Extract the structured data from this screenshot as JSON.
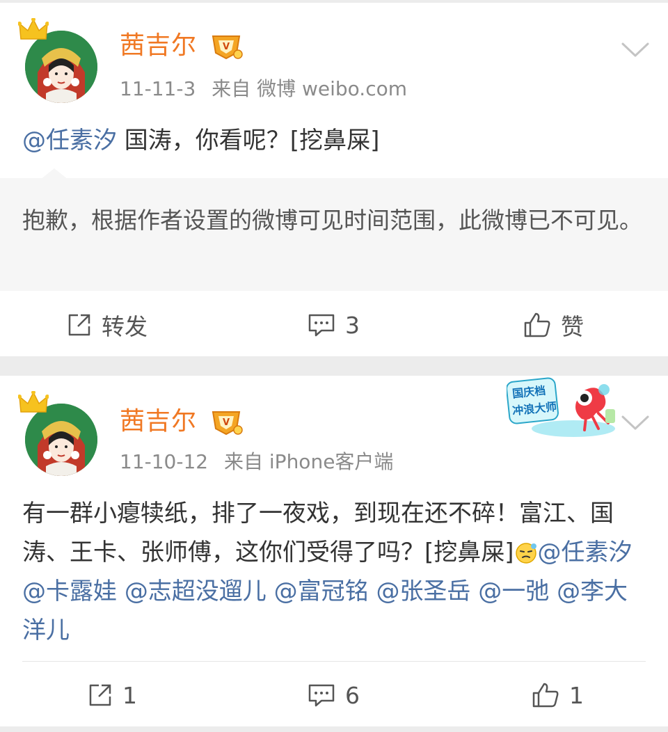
{
  "posts": [
    {
      "author": "茜吉尔",
      "date": "11-11-3",
      "source": "来自 微博 weibo.com",
      "content": {
        "mention": "@任素汐",
        "text": " 国涛，你看呢？[挖鼻屎]"
      },
      "quoted_notice": "抱歉，根据作者设置的微博可见时间范围，此微博已不可见。",
      "actions": {
        "repost": "转发",
        "comment": "3",
        "like": "赞"
      }
    },
    {
      "author": "茜吉尔",
      "date": "11-10-12",
      "source": "来自 iPhone客户端",
      "badge_sticker": [
        "国庆档",
        "冲浪大师"
      ],
      "content": {
        "text": "有一群小瘪犊纸，排了一夜戏，到现在还不碎！富江、国涛、王卡、张师傅，这你们受得了吗？[挖鼻屎]",
        "mentions": [
          "@任素汐",
          "@卡露娃",
          "@志超没遛儿",
          "@富冠铭",
          "@张圣岳",
          "@一弛",
          "@李大洋儿"
        ]
      },
      "actions": {
        "repost": "1",
        "comment": "6",
        "like": "1"
      }
    }
  ],
  "colors": {
    "author_name": "#f07823",
    "mention": "#4a6fa3",
    "meta": "#8a8a8a",
    "background": "#ececec"
  },
  "icons": [
    "crown-icon",
    "vip-badge-icon",
    "chevron-down-icon",
    "repost-icon",
    "comment-icon",
    "like-icon",
    "emoji-icon"
  ]
}
